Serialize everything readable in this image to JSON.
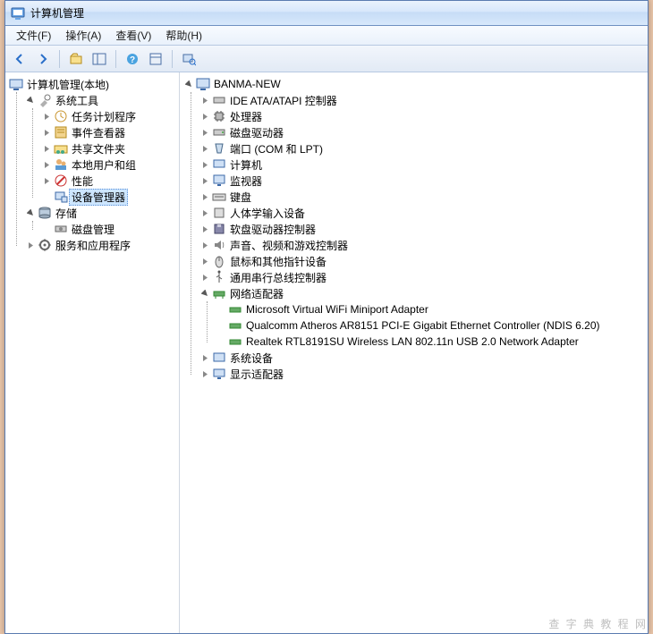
{
  "window": {
    "title": "计算机管理"
  },
  "menu": {
    "file": "文件(F)",
    "action": "操作(A)",
    "view": "查看(V)",
    "help": "帮助(H)"
  },
  "toolbar_icons": [
    "back",
    "forward",
    "up",
    "new-window",
    "refresh",
    "help",
    "properties",
    "show-hide"
  ],
  "left_tree": {
    "root": "计算机管理(本地)",
    "system_tools": {
      "label": "系统工具",
      "children": {
        "task_scheduler": "任务计划程序",
        "event_viewer": "事件查看器",
        "shared_folders": "共享文件夹",
        "local_users": "本地用户和组",
        "performance": "性能",
        "device_manager": "设备管理器"
      }
    },
    "storage": {
      "label": "存储",
      "disk_mgmt": "磁盘管理"
    },
    "services_apps": "服务和应用程序"
  },
  "right_tree": {
    "root": "BANMA-NEW",
    "items": {
      "ide": "IDE ATA/ATAPI 控制器",
      "cpu": "处理器",
      "disk": "磁盘驱动器",
      "ports": "端口 (COM 和 LPT)",
      "computer": "计算机",
      "monitor": "监视器",
      "keyboard": "键盘",
      "hid": "人体学输入设备",
      "floppy": "软盘驱动器控制器",
      "sound": "声音、视频和游戏控制器",
      "mouse": "鼠标和其他指针设备",
      "usb": "通用串行总线控制器",
      "network": {
        "label": "网络适配器",
        "adapters": [
          "Microsoft Virtual WiFi Miniport Adapter",
          "Qualcomm Atheros AR8151 PCI-E Gigabit Ethernet Controller (NDIS 6.20)",
          "Realtek RTL8191SU Wireless LAN 802.11n USB 2.0 Network Adapter"
        ]
      },
      "system_devices": "系统设备",
      "display": "显示适配器"
    }
  },
  "watermark": "查 字 典 教 程 网"
}
